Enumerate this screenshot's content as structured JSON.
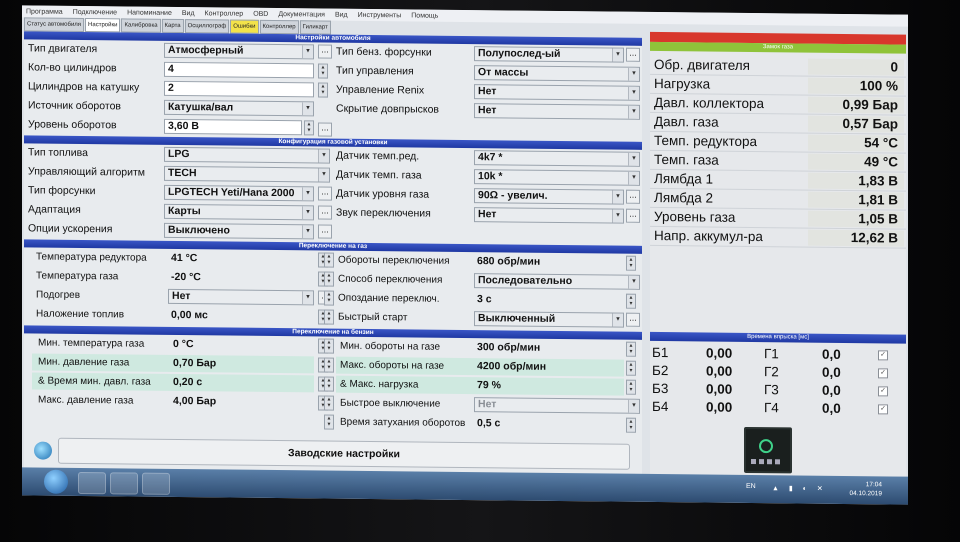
{
  "menu": [
    "Программа",
    "Подключение",
    "Напоминание",
    "Вид",
    "Контроллер",
    "OBD",
    "Документация",
    "Вид",
    "Инструменты",
    "Помощь"
  ],
  "tabs": [
    {
      "label": "Статус автомобиля",
      "active": false
    },
    {
      "label": "Настройки",
      "active": true
    },
    {
      "label": "Калибровка",
      "active": false
    },
    {
      "label": "Карта",
      "active": false
    },
    {
      "label": "Осциллограф",
      "active": false
    },
    {
      "label": "Ошибки",
      "active": false,
      "highlight": true
    },
    {
      "label": "Контроллер",
      "active": false
    },
    {
      "label": "Гиликарт",
      "active": false
    }
  ],
  "sections": {
    "car": "Настройки автомобиля",
    "gas_config": "Конфигурация газовой установки",
    "switch_gas": "Переключение на газ",
    "switch_petrol": "Переключение на бензин"
  },
  "car": {
    "left": [
      {
        "label": "Тип двигателя",
        "value": "Атмосферный",
        "kind": "combo"
      },
      {
        "label": "Кол-во цилиндров",
        "value": "4",
        "kind": "spin"
      },
      {
        "label": "Цилиндров на катушку",
        "value": "2",
        "kind": "spin"
      },
      {
        "label": "Источник оборотов",
        "value": "Катушка/вал",
        "kind": "combo"
      },
      {
        "label": "Уровень оборотов",
        "value": "3,60 В",
        "kind": "spin"
      }
    ],
    "right": [
      {
        "label": "Тип бенз. форсунки",
        "value": "Полупослед-ый"
      },
      {
        "label": "Тип управления",
        "value": "От массы"
      },
      {
        "label": "Управление Renix",
        "value": "Нет"
      },
      {
        "label": "Скрытие довпрысков",
        "value": "Нет"
      }
    ]
  },
  "gas_config": {
    "left": [
      {
        "label": "Тип топлива",
        "value": "LPG"
      },
      {
        "label": "Управляющий алгоритм",
        "value": "TECH"
      },
      {
        "label": "Тип форсунки",
        "value": "LPGTECH Yeti/Hana 2000"
      },
      {
        "label": "Адаптация",
        "value": "Карты"
      },
      {
        "label": "Опции ускорения",
        "value": "Выключено"
      }
    ],
    "right": [
      {
        "label": "Датчик темп.ред.",
        "value": "4k7 *"
      },
      {
        "label": "Датчик темп. газа",
        "value": "10k *"
      },
      {
        "label": "Датчик уровня газа",
        "value": "90Ω - увелич."
      },
      {
        "label": "Звук переключения",
        "value": "Нет"
      }
    ]
  },
  "switch_gas": {
    "left": [
      {
        "label": "Температура редуктора",
        "value": "41 °C"
      },
      {
        "label": "Температура газа",
        "value": "-20 °C"
      },
      {
        "label": "Подогрев",
        "value": "Нет"
      },
      {
        "label": "Наложение топлив",
        "value": "0,00 мс"
      }
    ],
    "right": [
      {
        "label": "Обороты переключения",
        "value": "680 обр/мин"
      },
      {
        "label": "Способ переключения",
        "value": "Последовательно"
      },
      {
        "label": "Опоздание переключ.",
        "value": "3 с"
      },
      {
        "label": "Быстрый старт",
        "value": "Выключенный"
      }
    ]
  },
  "switch_petrol": {
    "left": [
      {
        "label": "Мин. температура газа",
        "value": "0 °C"
      },
      {
        "label": "Мин. давление газа",
        "value": "0,70 Бар"
      },
      {
        "label": "& Время мин. давл. газа",
        "value": "0,20 с"
      },
      {
        "label": "Макс. давление газа",
        "value": "4,00 Бар"
      }
    ],
    "right": [
      {
        "label": "Мин. обороты на газе",
        "value": "300 обр/мин"
      },
      {
        "label": "Макс. обороты на газе",
        "value": "4200 обр/мин"
      },
      {
        "label": "& Макс. нагрузка",
        "value": "79 %"
      },
      {
        "label": "Быстрое выключение",
        "value": "Нет"
      },
      {
        "label": "Время затухания оборотов",
        "value": "0,5 с"
      }
    ]
  },
  "factory_button": "Заводские настройки",
  "status_bar_label": "Замок газа",
  "monitor": [
    {
      "label": "Обр. двигателя",
      "value": "0"
    },
    {
      "label": "Нагрузка",
      "value": "100 %"
    },
    {
      "label": "Давл. коллектора",
      "value": "0,99 Бар"
    },
    {
      "label": "Давл. газа",
      "value": "0,57 Бар"
    },
    {
      "label": "Темп. редуктора",
      "value": "54 °C"
    },
    {
      "label": "Темп. газа",
      "value": "49 °C"
    },
    {
      "label": "Лямбда 1",
      "value": "1,83 В"
    },
    {
      "label": "Лямбда 2",
      "value": "1,81 В"
    },
    {
      "label": "Уровень газа",
      "value": "1,05 В"
    },
    {
      "label": "Напр. аккумул-ра",
      "value": "12,62 В"
    }
  ],
  "injection": {
    "title": "Времена впрыска [мс]",
    "rows": [
      {
        "b": "Б1",
        "bv": "0,00",
        "g": "Г1",
        "gv": "0,0"
      },
      {
        "b": "Б2",
        "bv": "0,00",
        "g": "Г2",
        "gv": "0,0"
      },
      {
        "b": "Б3",
        "bv": "0,00",
        "g": "Г3",
        "gv": "0,0"
      },
      {
        "b": "Б4",
        "bv": "0,00",
        "g": "Г4",
        "gv": "0,0"
      }
    ]
  },
  "taskbar": {
    "lang": "EN",
    "time": "17:04",
    "date": "04.10.2019"
  }
}
